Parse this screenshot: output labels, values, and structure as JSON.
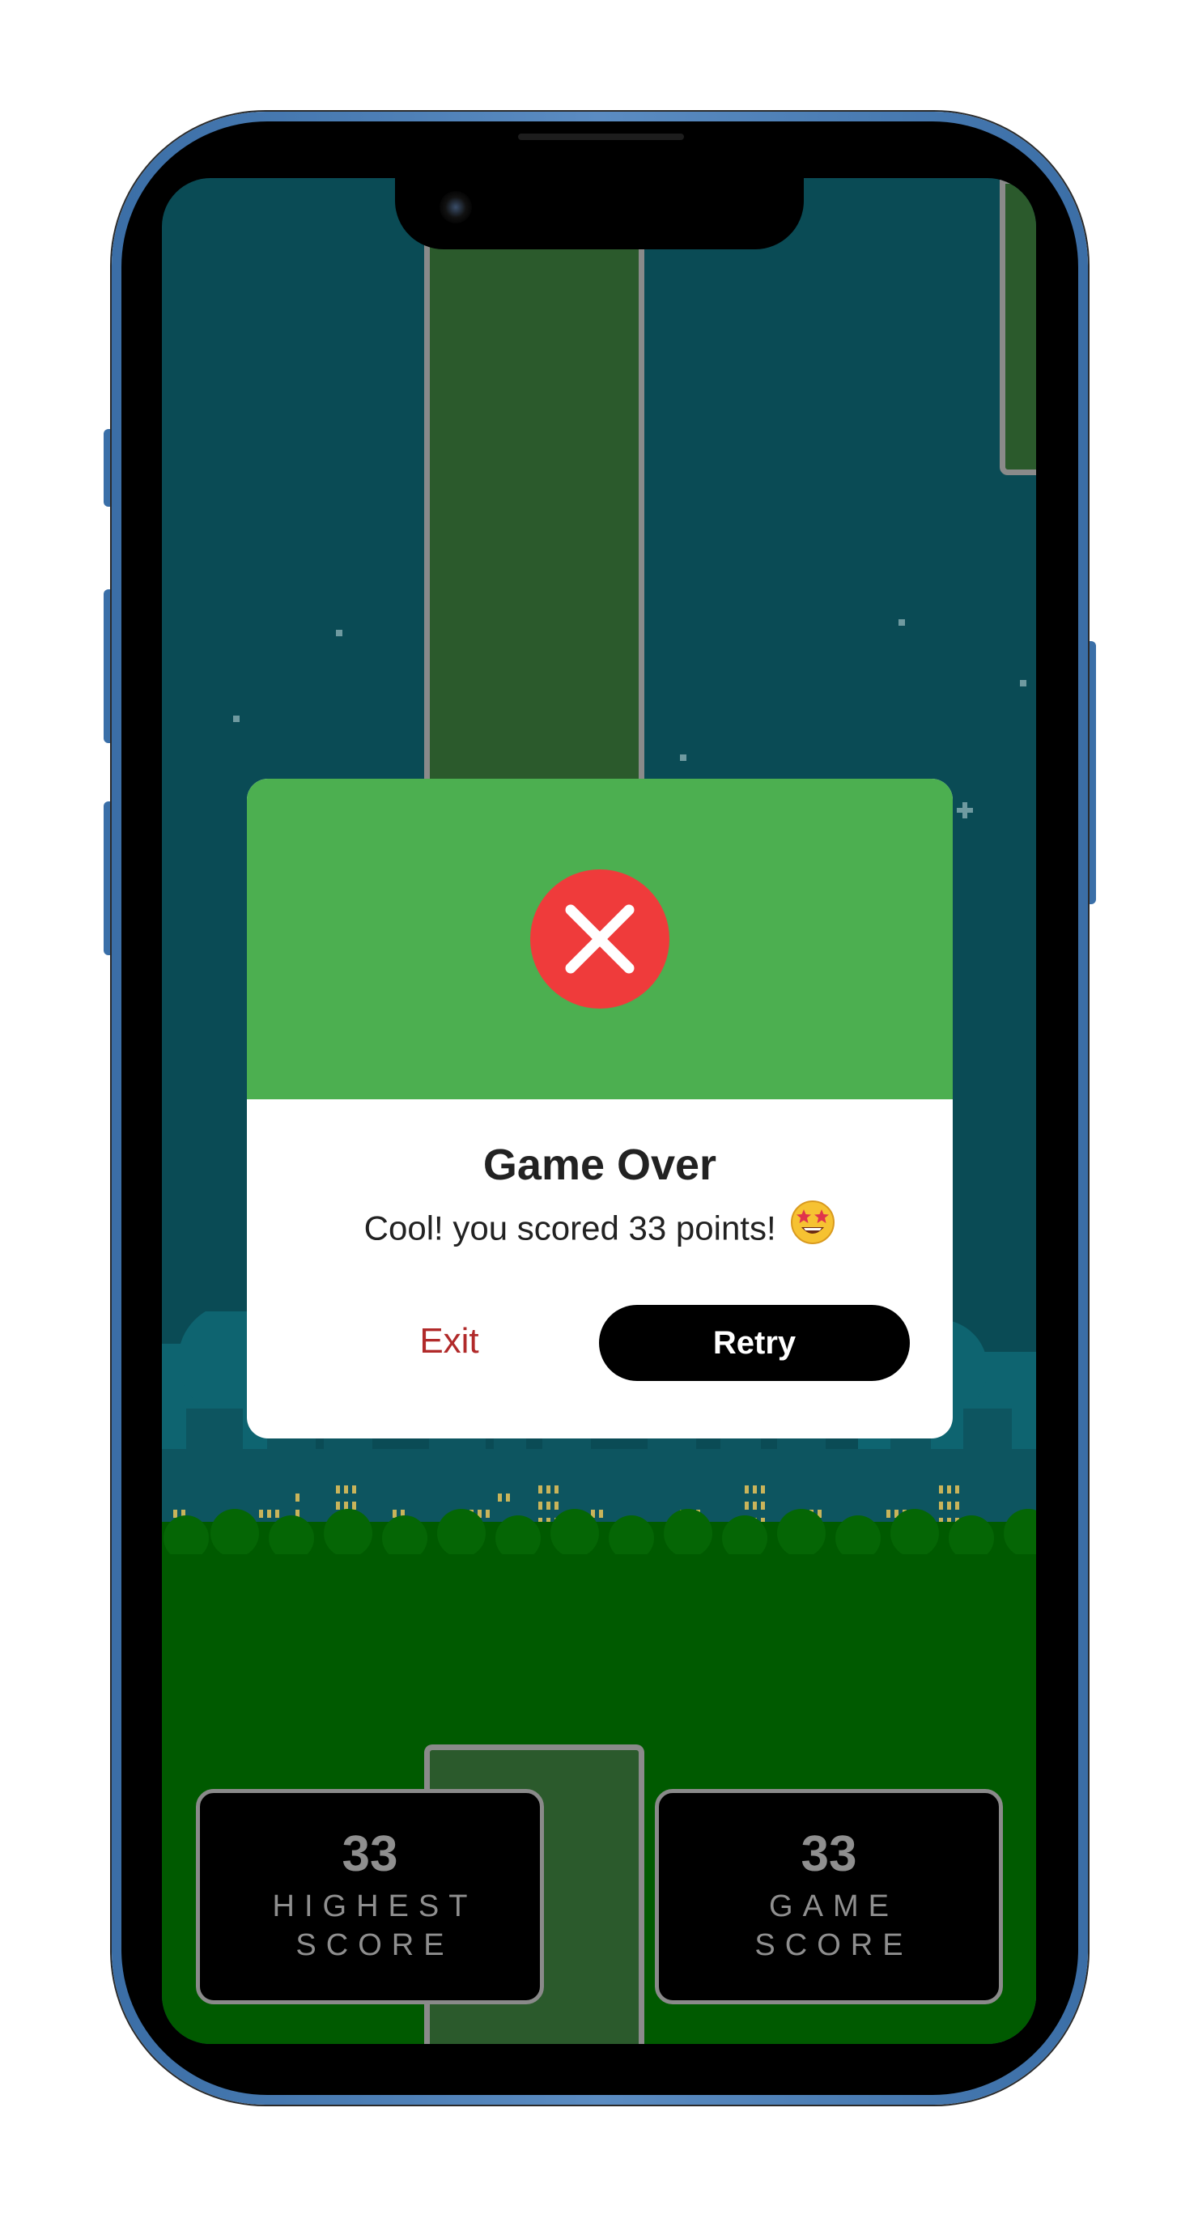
{
  "modal": {
    "title": "Game Over",
    "message": "Cool! you scored 33 points!",
    "emoji": "star-struck",
    "icon": "close-icon",
    "exit_label": "Exit",
    "retry_label": "Retry"
  },
  "scores": {
    "highest": {
      "value": "33",
      "label": "HIGHEST\nSCORE"
    },
    "game": {
      "value": "33",
      "label": "GAME\nSCORE"
    }
  },
  "colors": {
    "sky": "#0a4b55",
    "pipe": "#2b5a2c",
    "pipe_border": "#8a8a8a",
    "ground": "#005a00",
    "modal_header": "#4caf50",
    "error": "#ef3b3b",
    "exit_text": "#b12a2a",
    "phone_frame": "#3b6ea6"
  }
}
